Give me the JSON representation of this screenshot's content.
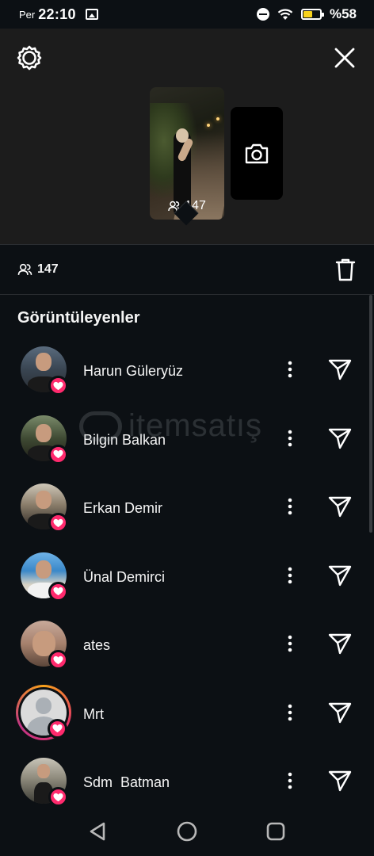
{
  "status_bar": {
    "day": "Per",
    "time": "22:10",
    "battery_level": 0.58,
    "battery_text": "%58",
    "battery_color": "#f7d21c"
  },
  "top_panel": {
    "settings_icon": "settings-gear-icon",
    "close_icon": "close-icon",
    "story_views": "147",
    "camera_icon": "camera-icon"
  },
  "viewer_header": {
    "count": "147",
    "viewers_icon": "viewers-icon",
    "delete_icon": "trash-icon"
  },
  "section_title": "Görüntüleyenler",
  "viewers": [
    {
      "name": "Harun Güleryüz"
    },
    {
      "name": "Bilgin Balkan"
    },
    {
      "name": "Erkan Demir"
    },
    {
      "name": "Ünal Demirci"
    },
    {
      "name": "ates"
    },
    {
      "name": "Mrt"
    },
    {
      "name": "Sdm  Batman"
    }
  ],
  "watermark": "itemsatış",
  "colors": {
    "background": "#0c1014",
    "panel": "#1c1c1c",
    "like_badge": "#ff2a6d",
    "text": "#f5f5f5"
  },
  "nav_bar": {
    "back_icon": "back-triangle-icon",
    "home_icon": "home-circle-icon",
    "recents_icon": "recents-square-icon"
  }
}
